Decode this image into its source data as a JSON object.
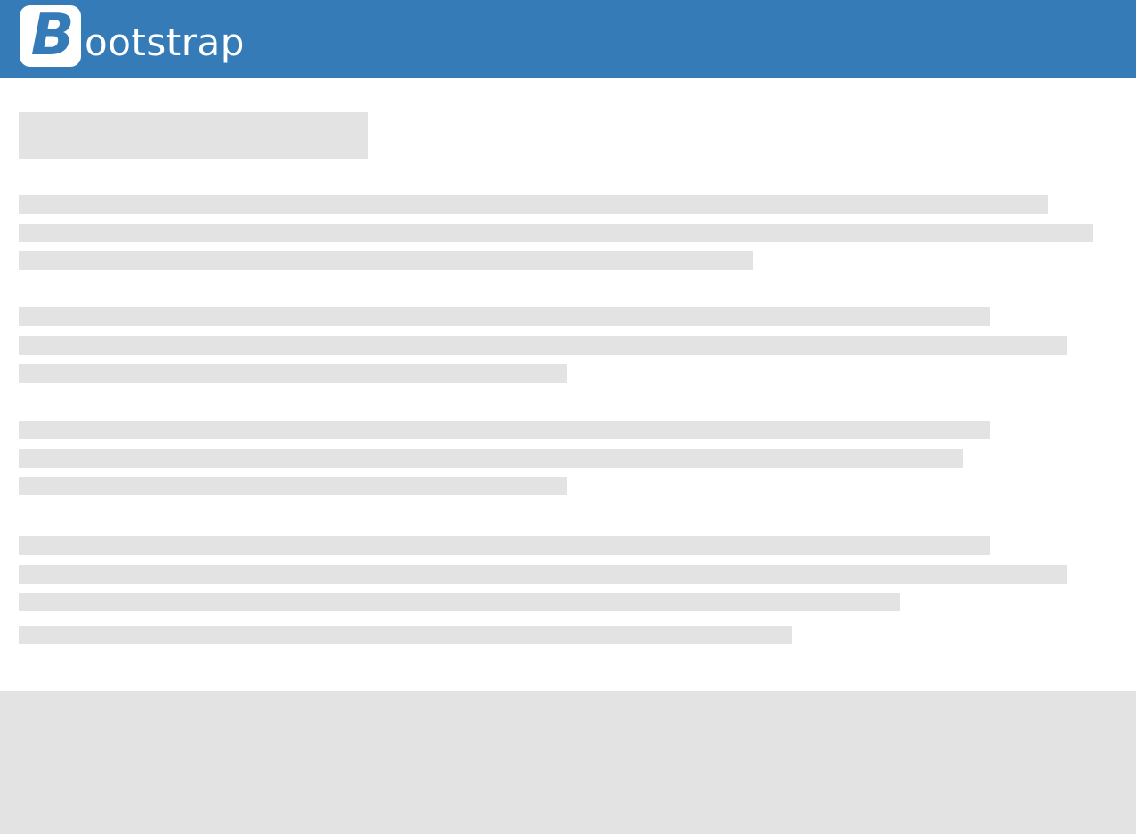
{
  "header": {
    "logo_mark": "B",
    "logo_text": "ootstrap",
    "background_color": "#357bb7"
  },
  "placeholder_color": "#e3e3e3",
  "main": {
    "heading_placeholder": {
      "kind": "title"
    },
    "paragraphs": [
      {
        "lines": 3
      },
      {
        "lines": 3
      },
      {
        "lines": 3
      },
      {
        "lines": 4
      }
    ]
  },
  "footer": {
    "background_color": "#e3e3e3"
  }
}
